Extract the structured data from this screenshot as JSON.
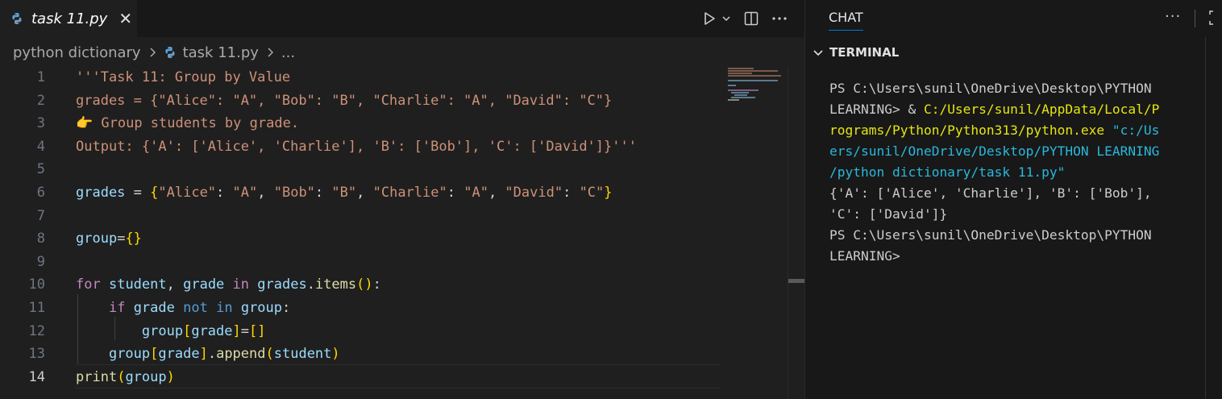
{
  "editor": {
    "tab_name": "task 11.py",
    "close_glyph": "✕",
    "breadcrumb": {
      "folder": "python dictionary",
      "file": "task 11.py",
      "more": "..."
    },
    "line_numbers": [
      "1",
      "2",
      "3",
      "4",
      "5",
      "6",
      "7",
      "8",
      "9",
      "10",
      "11",
      "12",
      "13",
      "14"
    ],
    "active_line": "14",
    "code": {
      "l1": "'''Task 11: Group by Value",
      "l2": "grades = {\"Alice\": \"A\", \"Bob\": \"B\", \"Charlie\": \"A\", \"David\": \"C\"}",
      "l3": "👉 Group students by grade.",
      "l4": "Output: {'A': ['Alice', 'Charlie'], 'B': ['Bob'], 'C': ['David']}'''",
      "l6": {
        "var": "grades",
        "eq": " = ",
        "open": "{",
        "k1": "\"Alice\"",
        "v1": "\"A\"",
        "k2": "\"Bob\"",
        "v2": "\"B\"",
        "k3": "\"Charlie\"",
        "v3": "\"A\"",
        "k4": "\"David\"",
        "v4": "\"C\"",
        "close": "}"
      },
      "l8": {
        "var": "group",
        "eq": "=",
        "braces": "{}"
      },
      "l10": {
        "kw_for": "for",
        "v_student": "student",
        "comma": ", ",
        "v_grade": "grade",
        "kw_in": "in",
        "v_grades": "grades",
        "dot": ".",
        "fn_items": "items",
        "parens": "()",
        "colon": ":"
      },
      "l11": {
        "kw_if": "if",
        "v_grade": "grade",
        "kw_not": "not",
        "kw_in": "in",
        "v_group": "group",
        "colon": ":"
      },
      "l12": {
        "v_group": "group",
        "open": "[",
        "v_grade": "grade",
        "close": "]",
        "eq": "=",
        "list": "[]"
      },
      "l13": {
        "v_group": "group",
        "open": "[",
        "v_grade": "grade",
        "close": "]",
        "dot": ".",
        "fn_append": "append",
        "popen": "(",
        "v_student": "student",
        "pclose": ")"
      },
      "l14": {
        "fn_print": "print",
        "popen": "(",
        "v_group": "group",
        "pclose": ")"
      }
    }
  },
  "panel": {
    "chat_tab": "CHAT",
    "more": "···",
    "terminal_title": "TERMINAL",
    "terminal_lines": [
      {
        "plain": "PS C:\\Users\\sunil\\OneDrive\\Desktop\\PYTHON"
      },
      {
        "plain": "LEARNING> & ",
        "yellow": "C:/Users/sunil/AppData/Local/P"
      },
      {
        "yellow": "rograms/Python/Python313/python.exe",
        "blue": " \"c:/Us"
      },
      {
        "blue": "ers/sunil/OneDrive/Desktop/PYTHON LEARNING"
      },
      {
        "blue": "/python dictionary/task 11.py\""
      },
      {
        "plain": "{'A': ['Alice', 'Charlie'], 'B': ['Bob'],"
      },
      {
        "plain": "'C': ['David']}"
      },
      {
        "plain": "PS C:\\Users\\sunil\\OneDrive\\Desktop\\PYTHON"
      },
      {
        "plain": "LEARNING>"
      }
    ]
  },
  "icons": {
    "python_file": "python-file-icon",
    "run": "play-icon",
    "run_dropdown": "chevron-down-icon",
    "split": "split-editor-icon",
    "more": "ellipsis-icon",
    "breadcrumb_sep": "chevron-right-icon",
    "terminal_chevron": "chevron-down-icon",
    "maximize": "maximize-icon"
  },
  "colors": {
    "string": "#ce9178",
    "keyword": "#c586c0",
    "variable": "#9cdcfe",
    "function": "#dcdcaa",
    "bracket_gold": "#ffd700",
    "terminal_yellow": "#e5e510",
    "terminal_blue": "#29b8db"
  }
}
